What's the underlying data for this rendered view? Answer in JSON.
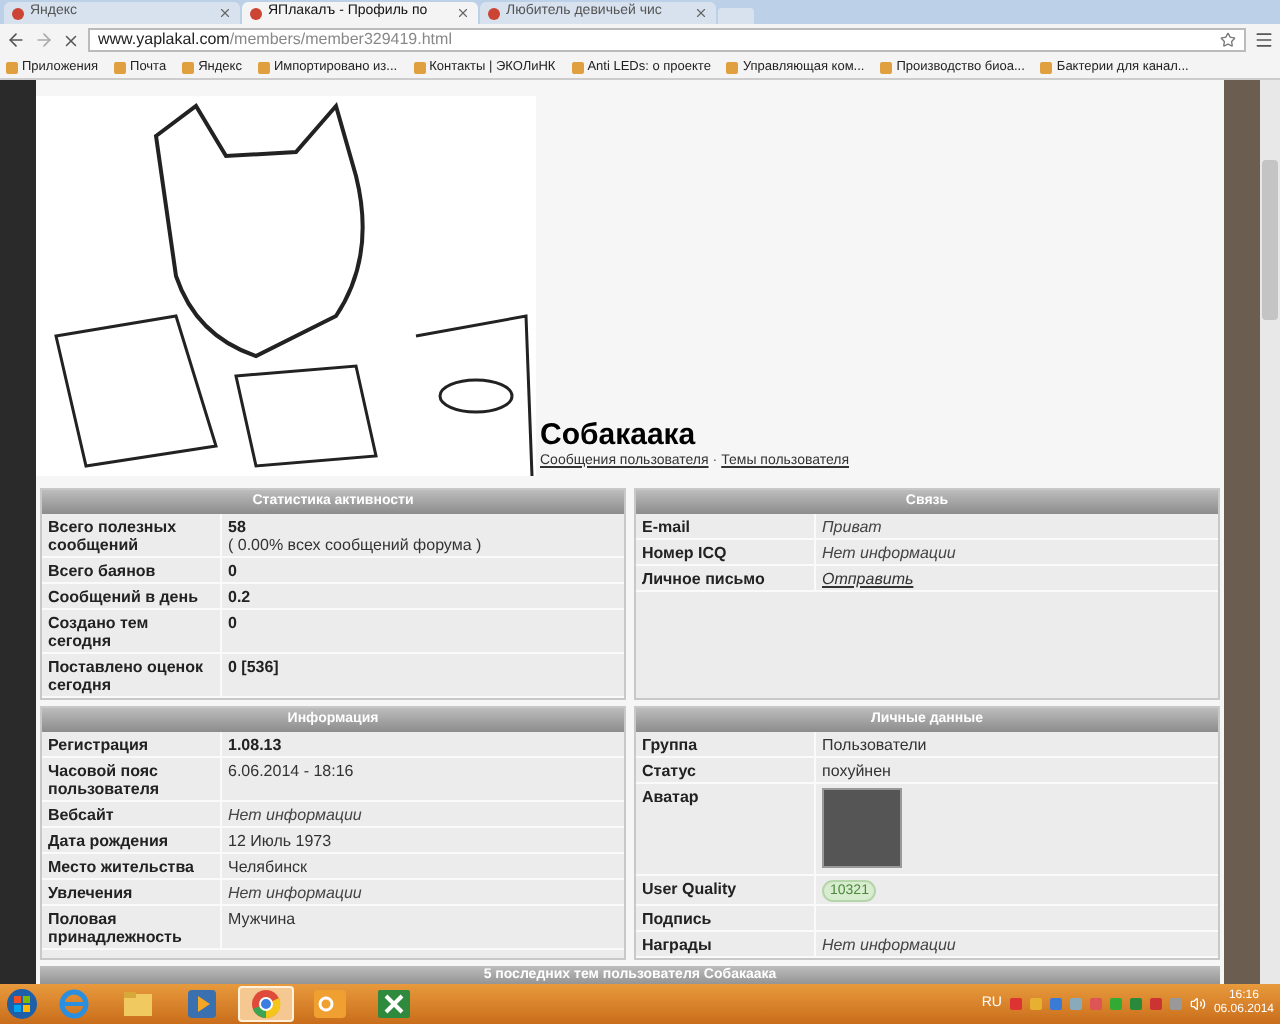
{
  "browser": {
    "tabs": [
      {
        "title": "Яндекс",
        "selected": false
      },
      {
        "title": "ЯПлакалъ - Профиль по",
        "selected": true
      },
      {
        "title": "Любитель девичьей чис",
        "selected": false
      }
    ],
    "url_host": "www.yaplakal.com",
    "url_path": "/members/member329419.html",
    "bookmarks": [
      "Приложения",
      "Почта",
      "Яндекс",
      "Импортировано из...",
      "Контакты | ЭКОЛиНК",
      "Anti LEDs: о проекте",
      "Управляющая ком...",
      "Производство биоа...",
      "Бактерии для канал..."
    ]
  },
  "profile": {
    "name": "Собакаака",
    "links": [
      "Сообщения пользователя",
      "Темы пользователя"
    ],
    "link_separator": "·"
  },
  "panels": [
    {
      "title": "Статистика активности",
      "rows": [
        {
          "label": "Всего полезных сообщений",
          "value": "58",
          "note": "( 0.00% всех сообщений форума )",
          "kind": "bold"
        },
        {
          "label": "Всего баянов",
          "value": "0",
          "kind": "bold"
        },
        {
          "label": "Сообщений в день",
          "value": "0.2",
          "kind": "bold"
        },
        {
          "label": "Создано тем сегодня",
          "value": "0",
          "kind": "bold"
        },
        {
          "label": "Поставлено оценок сегодня",
          "value": "0 [536]",
          "kind": "bold"
        }
      ]
    },
    {
      "title": "Связь",
      "rows": [
        {
          "label": "E-mail",
          "value": "Приват",
          "kind": "italic"
        },
        {
          "label": "Номер ICQ",
          "value": "Нет информации",
          "kind": "italic"
        },
        {
          "label": "Личное письмо",
          "value": "Отправить",
          "kind": "link"
        }
      ]
    },
    {
      "title": "Информация",
      "rows": [
        {
          "label": "Регистрация",
          "value": "1.08.13",
          "kind": "bold"
        },
        {
          "label": "Часовой пояс пользователя",
          "value": "6.06.2014 - 18:16",
          "kind": "plain"
        },
        {
          "label": "Вебсайт",
          "value": "Нет информации",
          "kind": "italic"
        },
        {
          "label": "Дата рождения",
          "value": "12 Июль 1973",
          "kind": "plain"
        },
        {
          "label": "Место жительства",
          "value": "Челябинск",
          "kind": "plain"
        },
        {
          "label": "Увлечения",
          "value": "Нет информации",
          "kind": "italic"
        },
        {
          "label": "Половая принадлежность",
          "value": "Мужчина",
          "kind": "plain"
        }
      ]
    },
    {
      "title": "Личные данные",
      "rows": [
        {
          "label": "Группа",
          "value": "Пользователи",
          "kind": "plain"
        },
        {
          "label": "Статус",
          "value": "похуйнен",
          "kind": "plain"
        },
        {
          "label": "Аватар",
          "kind": "avatar"
        },
        {
          "label": "User Quality",
          "value": "10321",
          "kind": "badge"
        },
        {
          "label": "Подпись",
          "kind": "empty"
        },
        {
          "label": "Награды",
          "value": "Нет информации",
          "kind": "italic"
        }
      ]
    }
  ],
  "recent_topics_title": "5 последних тем пользователя Собакаака",
  "taskbar": {
    "apps": [
      {
        "kind": "ie",
        "selected": false
      },
      {
        "kind": "folder",
        "selected": false
      },
      {
        "kind": "media",
        "selected": false
      },
      {
        "kind": "chrome",
        "selected": true
      },
      {
        "kind": "outlook",
        "selected": false
      },
      {
        "kind": "excel",
        "selected": false
      }
    ],
    "language": "RU",
    "time": "16:16",
    "date": "06.06.2014"
  }
}
